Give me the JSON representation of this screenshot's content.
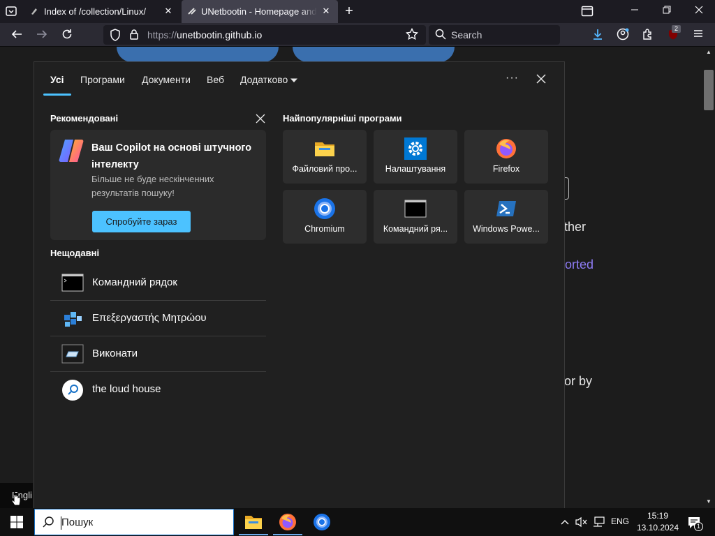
{
  "browser": {
    "tabs": [
      {
        "title": "Index of /collection/Linux/"
      },
      {
        "title": "UNetbootin - Homepage and Do"
      }
    ],
    "url_scheme": "https://",
    "url_host": "unetbootin.github.io",
    "search_placeholder": "Search",
    "extension_badge": "2"
  },
  "page_fragments": {
    "text1": "ther",
    "link1": "orted",
    "text2": "or by",
    "language_tip": "Engli"
  },
  "start_panel": {
    "tabs": [
      "Усі",
      "Програми",
      "Документи",
      "Веб",
      "Додатково"
    ],
    "more_label": "···",
    "recommended_heading": "Рекомендовані",
    "copilot_title": "Ваш Copilot на основі штучного інтелекту",
    "copilot_desc": "Більше не буде нескінченних результатів пошуку!",
    "try_button": "Спробуйте зараз",
    "recent_heading": "Нещодавні",
    "recent_items": [
      {
        "label": "Командний рядок",
        "icon": "cmd-icon"
      },
      {
        "label": "Επεξεργαστής Μητρώου",
        "icon": "regedit-icon"
      },
      {
        "label": "Виконати",
        "icon": "run-icon"
      },
      {
        "label": "the loud house",
        "icon": "search-icon"
      }
    ],
    "top_apps_heading": "Найпопулярніші програми",
    "top_apps": [
      {
        "label": "Файловий про...",
        "icon": "file-explorer-icon"
      },
      {
        "label": "Налаштування",
        "icon": "settings-icon"
      },
      {
        "label": "Firefox",
        "icon": "firefox-icon"
      },
      {
        "label": "Chromium",
        "icon": "chromium-icon"
      },
      {
        "label": "Командний ря...",
        "icon": "cmd-icon"
      },
      {
        "label": "Windows Powe...",
        "icon": "powershell-icon"
      }
    ]
  },
  "taskbar": {
    "search_placeholder": "Пошук",
    "language": "ENG",
    "time": "15:19",
    "date": "13.10.2024",
    "notification_count": "1"
  }
}
